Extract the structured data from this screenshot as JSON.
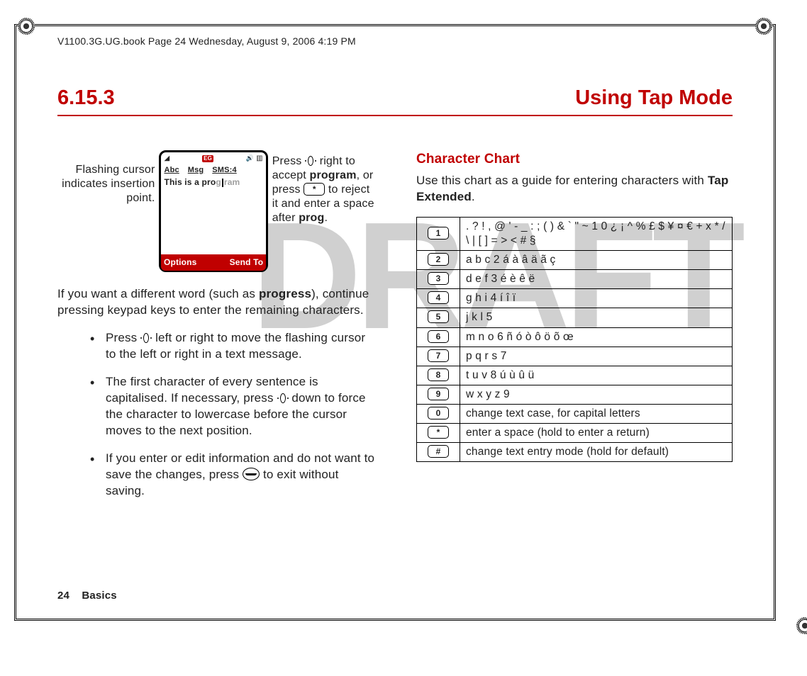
{
  "binding": "V1100.3G.UG.book  Page 24  Wednesday, August 9, 2006  4:19 PM",
  "heading": {
    "number": "6.15.3",
    "title": "Using Tap Mode"
  },
  "phone": {
    "tab1": "Abc",
    "tab2": "Msg",
    "tab3": "SMS:4",
    "msg_prefix": "This is a pro",
    "msg_ghost_head": "g",
    "msg_ghost_tail": "ram",
    "soft_left": "Options",
    "soft_right": "Send To"
  },
  "annot_left": "Flashing cursor indicates insertion point.",
  "annot_right_1": "Press ",
  "annot_right_2": " right to accept ",
  "annot_right_prog": "program",
  "annot_right_3": ", or press ",
  "annot_right_key": "*",
  "annot_right_4": " to reject it and enter a space after ",
  "annot_right_prog2": "prog",
  "annot_right_5": ".",
  "para1_a": "If you want a different word (such as ",
  "para1_bold": "progress",
  "para1_b": "), continue pressing keypad keys to enter the remaining characters.",
  "b1_a": "Press ",
  "b1_b": " left or right to move the flashing cursor to the left or right in a text message.",
  "b2_a": "The first character of every sentence is capitalised. If necessary, press ",
  "b2_b": " down to force the character to lowercase before the cursor moves to the next position.",
  "b3_a": "If you enter or edit information and do not want to save the changes, press ",
  "b3_b": " to exit without saving.",
  "charchart_heading": "Character Chart",
  "charchart_intro_a": "Use this chart as a guide for entering characters with ",
  "charchart_intro_b": "Tap Extended",
  "charchart_intro_c": ".",
  "rows": [
    {
      "key": "1",
      "val": ". ? ! , @ ' - _ : ; ( ) & ` \" ~ 1 0 ¿ ¡ ^ % £ $ ¥ ¤ € + x * / \\ | [ ] = > < # §"
    },
    {
      "key": "2",
      "val": "a b c 2 á à â ä ã ç"
    },
    {
      "key": "3",
      "val": "d e f 3 é è ê ë"
    },
    {
      "key": "4",
      "val": "g h i 4 í î ï"
    },
    {
      "key": "5",
      "val": "j k l 5"
    },
    {
      "key": "6",
      "val": "m n o 6 ñ ó ò ô ö õ œ"
    },
    {
      "key": "7",
      "val": "p q r s 7"
    },
    {
      "key": "8",
      "val": "t u v 8 ú ù û ü"
    },
    {
      "key": "9",
      "val": "w x y z 9"
    },
    {
      "key": "0",
      "val": "change text case, for capital letters"
    },
    {
      "key": "*",
      "val": "enter a space (hold to enter a return)"
    },
    {
      "key": "#",
      "val": "change text entry mode (hold for default)"
    }
  ],
  "footer_page": "24",
  "footer_section": "Basics"
}
